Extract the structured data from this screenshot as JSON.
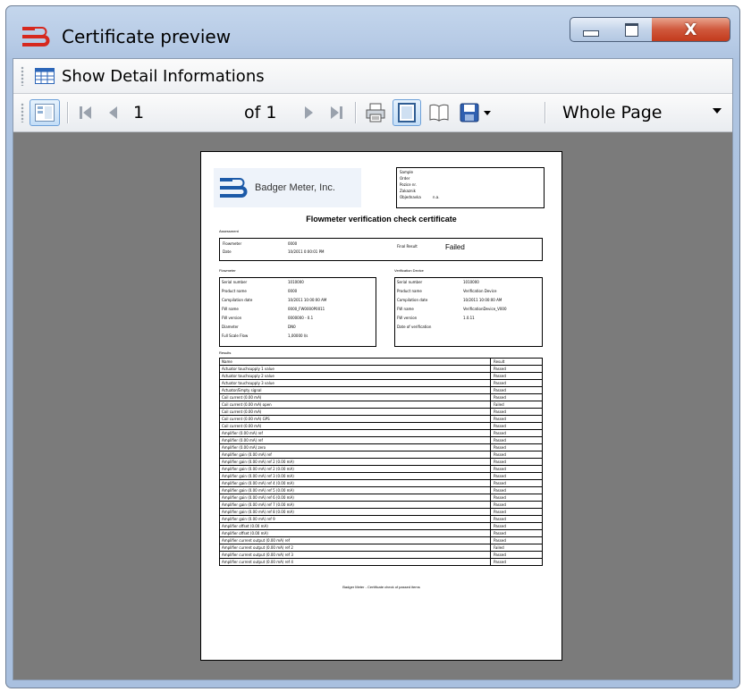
{
  "window": {
    "title": "Certificate preview",
    "close_glyph": "X",
    "colors": {
      "titlebar": "#b7cbe6",
      "close": "#c94a2c",
      "viewport": "#7b7b7b",
      "accent_red": "#d6281e",
      "brand_blue": "#1c5aa8"
    }
  },
  "menu": {
    "show_detail_label": "Show Detail Informations",
    "show_detail_icon": "table-icon"
  },
  "toolbar": {
    "page_current": "1",
    "page_of": "of 1",
    "zoom_value": "Whole Page",
    "icons": [
      "toggle-tree-icon",
      "first-page-icon",
      "previous-page-icon",
      "next-page-icon",
      "last-page-icon",
      "print-icon",
      "page-layout-icon",
      "two-page-icon",
      "save-icon",
      "save-dropdown-icon",
      "zoom-dropdown-icon"
    ]
  },
  "report": {
    "company": "Badger Meter, Inc.",
    "heading": "Flowmeter verification check certificate",
    "top_right_labels": [
      "Sample",
      "Order",
      "Pozice nr.",
      "Zakaznik",
      "Objednavka"
    ],
    "top_right_value": "n.a.",
    "section_assessment": "Assessment",
    "assessment": [
      {
        "label": "Flowmeter",
        "value": "0000"
      },
      {
        "label": "Date",
        "value": "10/2011 0:00:01 PM"
      }
    ],
    "final_result_label": "Final Result",
    "final_result_value": "Failed",
    "section_flowmeter": "Flowmeter",
    "flowmeter": [
      {
        "label": "Serial number",
        "value": "1010000"
      },
      {
        "label": "Product name",
        "value": "0000"
      },
      {
        "label": "Compilation date",
        "value": "10/2011 10:00:00 AM"
      },
      {
        "label": "FW name",
        "value": "0000_FW0000P0011"
      },
      {
        "label": "FW version",
        "value": "0000000 - 0.1"
      },
      {
        "label": "Diameter",
        "value": "DN0"
      },
      {
        "label": "Full Scale Flow",
        "value": "1,00000 l/s"
      }
    ],
    "section_verification": "Verification Device",
    "verification": [
      {
        "label": "Serial number",
        "value": "1010000"
      },
      {
        "label": "Product name",
        "value": "Verification Device"
      },
      {
        "label": "Compilation date",
        "value": "10/2011 10:00:00 AM"
      },
      {
        "label": "FW name",
        "value": "VerificationDevice_V000"
      },
      {
        "label": "FW version",
        "value": "1.0.11"
      },
      {
        "label": "Date of verification",
        "value": ""
      }
    ],
    "section_results": "Results",
    "results_header": {
      "name": "Name",
      "result": "Result"
    },
    "results": [
      {
        "name": "Actuator touchsupply 1 value",
        "result": "Passed"
      },
      {
        "name": "Actuator touchsupply 2 value",
        "result": "Passed"
      },
      {
        "name": "Actuator touchsupply 3 value",
        "result": "Passed"
      },
      {
        "name": "Actuator/Empty signal",
        "result": "Passed"
      },
      {
        "name": "Coil current (0.00 mA)",
        "result": "Passed"
      },
      {
        "name": "Coil current (0.00 mA) open",
        "result": "Failed"
      },
      {
        "name": "Coil current (0.00 mA)",
        "result": "Passed"
      },
      {
        "name": "Coil current (0.00 mA) GPS",
        "result": "Passed"
      },
      {
        "name": "Coil current (0.00 mA)",
        "result": "Passed"
      },
      {
        "name": "Amplifier (0.00 mA) ref",
        "result": "Passed"
      },
      {
        "name": "Amplifier (0.00 mA) ref",
        "result": "Passed"
      },
      {
        "name": "Amplifier (0.00 mA) zero",
        "result": "Passed"
      },
      {
        "name": "Amplifier gain (0.00 mA) ref",
        "result": "Passed"
      },
      {
        "name": "Amplifier gain (0.00 mA) ref 2 (0.00 mA)",
        "result": "Passed"
      },
      {
        "name": "Amplifier gain (0.00 mA) ref 2 (0.00 mA)",
        "result": "Passed"
      },
      {
        "name": "Amplifier gain (0.00 mA) ref 3 (0.00 mA)",
        "result": "Passed"
      },
      {
        "name": "Amplifier gain (0.00 mA) ref 4 (0.00 mA)",
        "result": "Passed"
      },
      {
        "name": "Amplifier gain (0.00 mA) ref 5 (0.00 mA)",
        "result": "Passed"
      },
      {
        "name": "Amplifier gain (0.00 mA) ref 6 (0.00 mA)",
        "result": "Passed"
      },
      {
        "name": "Amplifier gain (0.00 mA) ref 7 (0.00 mA)",
        "result": "Passed"
      },
      {
        "name": "Amplifier gain (0.00 mA) ref 8 (0.00 mA)",
        "result": "Passed"
      },
      {
        "name": "Amplifier gain (0.00 mA) ref 9",
        "result": "Passed"
      },
      {
        "name": "Amplifier offset (0.00 mA)",
        "result": "Passed"
      },
      {
        "name": "Amplifier offset (0.00 mA)",
        "result": "Passed"
      },
      {
        "name": "Amplifier current output (0.00 mA) ref",
        "result": "Passed"
      },
      {
        "name": "Amplifier current output (0.00 mA) ref 2",
        "result": "Failed"
      },
      {
        "name": "Amplifier current output (0.00 mA) ref 3",
        "result": "Passed"
      },
      {
        "name": "Amplifier current output (0.00 mA) ref 4",
        "result": "Passed"
      }
    ],
    "footer": "Badger Meter - Certificate check of passed items"
  }
}
